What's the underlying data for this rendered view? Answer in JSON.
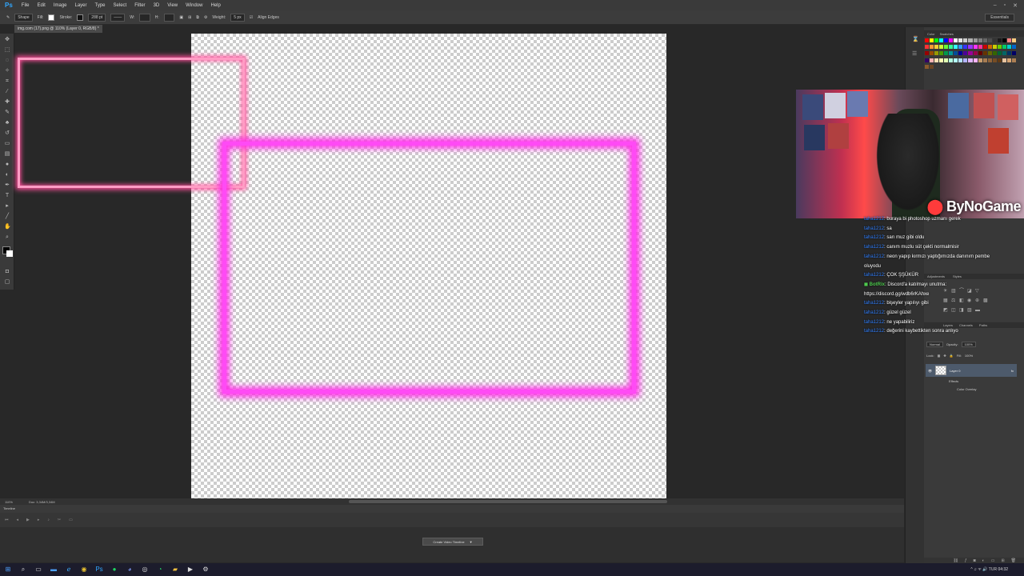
{
  "app": {
    "logo": "Ps",
    "menu": [
      "File",
      "Edit",
      "Image",
      "Layer",
      "Type",
      "Select",
      "Filter",
      "3D",
      "View",
      "Window",
      "Help"
    ],
    "window_controls": [
      "–",
      "▫",
      "✕"
    ]
  },
  "options": {
    "tool_mode": "Shape",
    "fill_label": "Fill:",
    "stroke_label": "Stroke:",
    "stroke_size": "288 pt",
    "w_label": "W:",
    "h_label": "H:",
    "weight_label": "Weight:",
    "weight_value": "5 px",
    "align_edges": "Align Edges",
    "workspace": "Essentials"
  },
  "document": {
    "tab_title": "img.com (17).png @ 110% (Layer 0, RGB/8) *",
    "zoom": "110%",
    "doc_info": "Doc: 3,34M/3,34M"
  },
  "timeline": {
    "label": "Timeline",
    "create_button": "Create Video Timeline",
    "dropdown_icon": "▼"
  },
  "panels": {
    "swatch_tabs": [
      "Color",
      "Swatches"
    ],
    "adjust_tabs": [
      "Adjustments",
      "Styles"
    ],
    "layers_tabs": [
      "Layers",
      "Channels",
      "Paths"
    ],
    "blend_mode": "Normal",
    "opacity_label": "Opacity:",
    "opacity_value": "100%",
    "lock_label": "Lock:",
    "fill_label": "Fill:",
    "fill_value": "100%",
    "layer_name": "Layer 0",
    "fx": "fx",
    "effects_label": "Effects",
    "color_overlay_label": "Color Overlay",
    "swatch_colors": [
      "#ff0000",
      "#ffff00",
      "#00ff00",
      "#00ffff",
      "#0000ff",
      "#ff00ff",
      "#ffffff",
      "#e6e6e6",
      "#cccccc",
      "#b3b3b3",
      "#999999",
      "#808080",
      "#666666",
      "#4d4d4d",
      "#333333",
      "#1a1a1a",
      "#000000",
      "#ff8080",
      "#ffcc80",
      "#ff3333",
      "#ff9933",
      "#ffcc33",
      "#ccff33",
      "#66ff33",
      "#33ff99",
      "#33ffff",
      "#3399ff",
      "#3333ff",
      "#9933ff",
      "#ff33ff",
      "#ff3399",
      "#cc0000",
      "#cc6600",
      "#cccc00",
      "#66cc00",
      "#00cc66",
      "#00cccc",
      "#0066cc",
      "#990000",
      "#994c00",
      "#999900",
      "#4c9900",
      "#00994c",
      "#009999",
      "#004c99",
      "#000099",
      "#4c0099",
      "#990099",
      "#99004c",
      "#660000",
      "#663300",
      "#666600",
      "#336600",
      "#006633",
      "#006666",
      "#003366",
      "#000066",
      "#330066",
      "#ffb3b3",
      "#ffe0b3",
      "#ffffb3",
      "#e0ffb3",
      "#b3ffe0",
      "#b3ffff",
      "#b3e0ff",
      "#b3b3ff",
      "#e0b3ff",
      "#ffb3ff",
      "#c69c6d",
      "#a67c52",
      "#8c6239",
      "#754c24",
      "#603913",
      "#e8c4a0",
      "#d4a373",
      "#ad7f53",
      "#8b5a2b",
      "#6b4423"
    ]
  },
  "stream": {
    "brand": "ByNoGame",
    "chat": [
      {
        "user": "taha1212",
        "text": ": buraya bi photoshop uzmanı gerek"
      },
      {
        "user": "taha1212",
        "text": ": sa"
      },
      {
        "user": "taha1212",
        "text": ": sarı muz gibi oldu"
      },
      {
        "user": "taha1212",
        "text": ": canım muzlu süt çekti normalmisir"
      },
      {
        "user": "taha1212",
        "text": ": neon yapıp kırmızı yaptığımızda danınım pembe"
      },
      {
        "user": "",
        "text": "oluyodu"
      },
      {
        "user": "taha1212",
        "text": ": ÇOK ŞŞÜKÜR"
      },
      {
        "user": "BotRix",
        "text": ": Discord'a katılmayı unutma:",
        "bot": true
      },
      {
        "user": "",
        "text": "https://discord.gg/wdb6rKAhxe"
      },
      {
        "user": "taha1212",
        "text": ": bişeyler yapılıyı gibi"
      },
      {
        "user": "taha1212",
        "text": ": güzel güzel"
      },
      {
        "user": "taha1212",
        "text": ": ne yapabiliriz"
      },
      {
        "user": "taha1212",
        "text": ": değerini kaybettikten sonra anlıyo"
      }
    ]
  },
  "taskbar": {
    "icons": [
      "windows-icon",
      "search-icon",
      "task-view-icon",
      "explorer-icon",
      "edge-icon",
      "chrome-icon",
      "photoshop-icon",
      "spotify-icon",
      "discord-icon",
      "obs-icon",
      "whatsapp-icon",
      "folder-icon",
      "media-icon",
      "settings-icon"
    ],
    "tray": "^ ♫ ᯤ 🔊 TUR",
    "clock": "04:32"
  }
}
